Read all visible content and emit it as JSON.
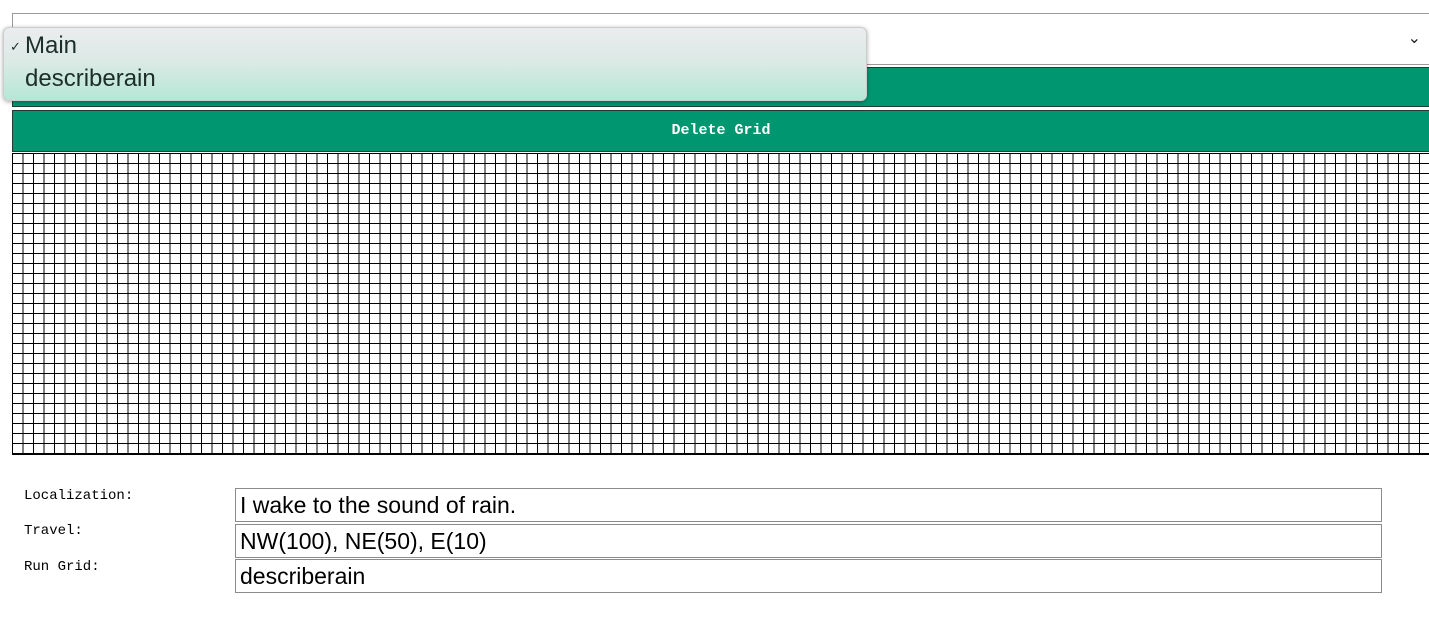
{
  "grid_select": {
    "options": [
      "Main",
      "describerain"
    ],
    "selected": "Main",
    "chevron_icon": "chevron-down-icon",
    "chevron_glyph": "⌄",
    "check_icon": "checkmark-icon",
    "check_glyph": "✓"
  },
  "buttons": {
    "run_label": "",
    "delete_label": "Delete Grid"
  },
  "fields": {
    "localization_label": "Localization:",
    "localization_value": "I wake to the sound of rain.",
    "travel_label": "Travel:",
    "travel_value": "NW(100), NE(50), E(10)",
    "rungrid_label": "Run Grid:",
    "rungrid_value": "describerain"
  },
  "colors": {
    "button_green": "#009670",
    "button_text": "#ffffff",
    "grid_line": "#000000"
  }
}
